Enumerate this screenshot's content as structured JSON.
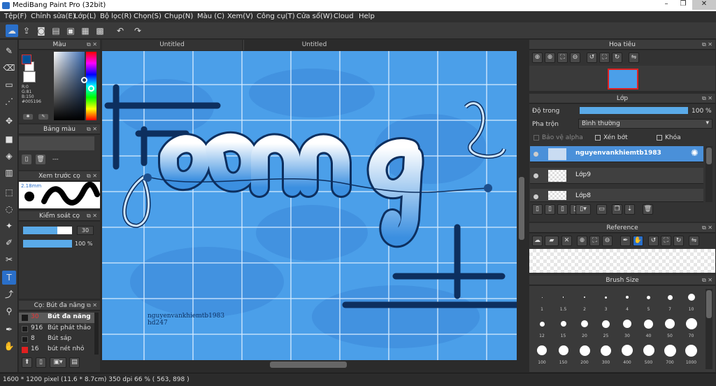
{
  "title": "MediBang Paint Pro (32bit)",
  "window_buttons": [
    "–",
    "❐",
    "✕"
  ],
  "menu": [
    "Tệp(F)",
    "Chỉnh sửa(E)",
    "Lớp(L)",
    "Bộ lọc(R)",
    "Chọn(S)",
    "Chụp(N)",
    "Màu (C)",
    "Xem(V)",
    "Công cụ(T)",
    "Cửa sổ(W)",
    "Cloud",
    "Help"
  ],
  "tabs": [
    "Untitled",
    "Untitled"
  ],
  "color_panel": {
    "title": "Màu",
    "r": "R:0",
    "g": "G:81",
    "b": "B:150",
    "hex": "#005196",
    "fg": "#005196",
    "bg": "#ffffff"
  },
  "palette_panel": {
    "title": "Bảng màu",
    "dash": "---"
  },
  "preview_panel": {
    "title": "Xem trước cọ",
    "size": "2.18mm"
  },
  "control_panel": {
    "title": "Kiểm soát cọ",
    "size": "30",
    "opacity": "100 %",
    "size_fill": 0.7,
    "opacity_fill": 1.0
  },
  "brush_panel": {
    "title": "Cọ: Bút đa năng",
    "brushes": [
      {
        "size": "30",
        "name": "Bút đa năng",
        "color": "#1a1a1a",
        "active": true
      },
      {
        "size": "916",
        "name": "Bút phát thảo",
        "color": "#1a1a1a",
        "active": false
      },
      {
        "size": "8",
        "name": "Bút sáp",
        "color": "#1a1a1a",
        "active": false
      },
      {
        "size": "16",
        "name": "bút nét nhỏ",
        "color": "#e02020",
        "active": false
      }
    ]
  },
  "navigator": {
    "title": "Hoa tiêu"
  },
  "layer_panel": {
    "title": "Lớp",
    "opacity_label": "Độ trong",
    "opacity_value": "100 %",
    "opacity_fill": 1.0,
    "blend_label": "Pha trộn",
    "blend_value": "Bình thường",
    "protect_alpha": "Bảo vệ alpha",
    "clip": "Xén bớt",
    "lock": "Khóa",
    "layers": [
      {
        "name": "nguyenvankhiemtb1983",
        "active": true
      },
      {
        "name": "Lớp9",
        "active": false
      },
      {
        "name": "Lớp8",
        "active": false
      }
    ]
  },
  "reference": {
    "title": "Reference"
  },
  "brush_size": {
    "title": "Brush Size",
    "sizes": [
      "1",
      "1.5",
      "2",
      "3",
      "4",
      "5",
      "7",
      "10",
      "12",
      "15",
      "20",
      "25",
      "30",
      "40",
      "50",
      "70",
      "100",
      "150",
      "200",
      "300",
      "400",
      "500",
      "700",
      "1000"
    ]
  },
  "canvas_text": {
    "line1": "nguyenvankhiemtb1983",
    "line2": "hd247",
    "art_word": "Young"
  },
  "status": "1600 * 1200 pixel  (11.6 * 8.7cm)  350 dpi  66 %  ( 563, 898 )"
}
